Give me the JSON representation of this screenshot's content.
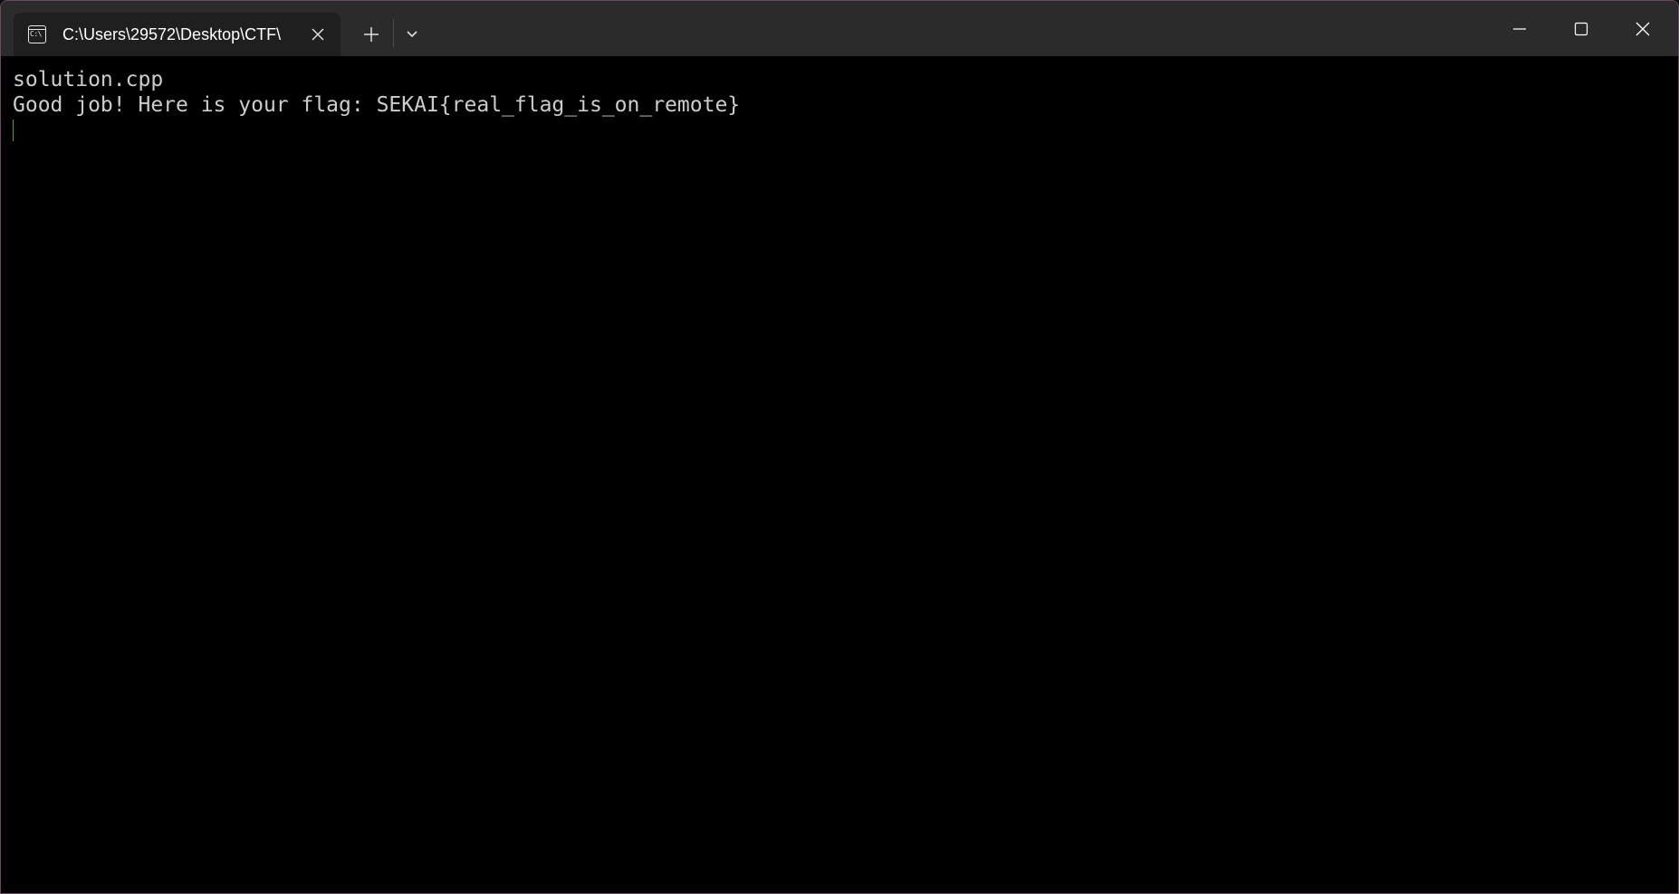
{
  "window": {
    "border_color": "#6a4a62",
    "titlebar_color": "#2b2b2b",
    "terminal_background": "#000000"
  },
  "tab": {
    "title": "C:\\Users\\29572\\Desktop\\CTF\\",
    "icon": "cmd-icon",
    "icon_glyph": "C:\\"
  },
  "tab_bar": {
    "new_tab_icon": "plus-icon",
    "dropdown_icon": "chevron-down-icon"
  },
  "caption_buttons": {
    "minimize_icon": "minimize-icon",
    "maximize_icon": "maximize-icon",
    "close_icon": "close-icon"
  },
  "terminal": {
    "lines": [
      "solution.cpp",
      "Good job! Here is your flag: SEKAI{real_flag_is_on_remote}"
    ],
    "text_color": "#cccccc",
    "cursor_color": "#2aa84a"
  }
}
